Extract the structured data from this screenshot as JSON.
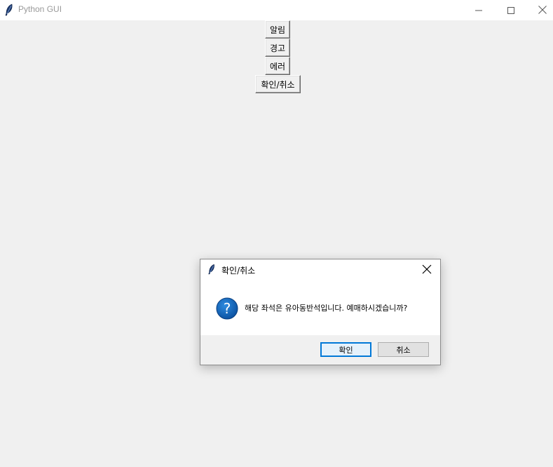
{
  "window": {
    "title": "Python GUI",
    "icon": "feather-icon",
    "controls": [
      "minimize-icon",
      "maximize-icon",
      "close-icon"
    ]
  },
  "buttons": {
    "info": "알림",
    "warning": "경고",
    "error": "에러",
    "ask": "확인/취소"
  },
  "dialog": {
    "title": "확인/취소",
    "icon": "question-icon",
    "message": "해당 좌석은 유아동반석입니다. 예매하시겠습니까?",
    "ok_label": "확인",
    "cancel_label": "취소",
    "accent_color": "#0078d7"
  }
}
